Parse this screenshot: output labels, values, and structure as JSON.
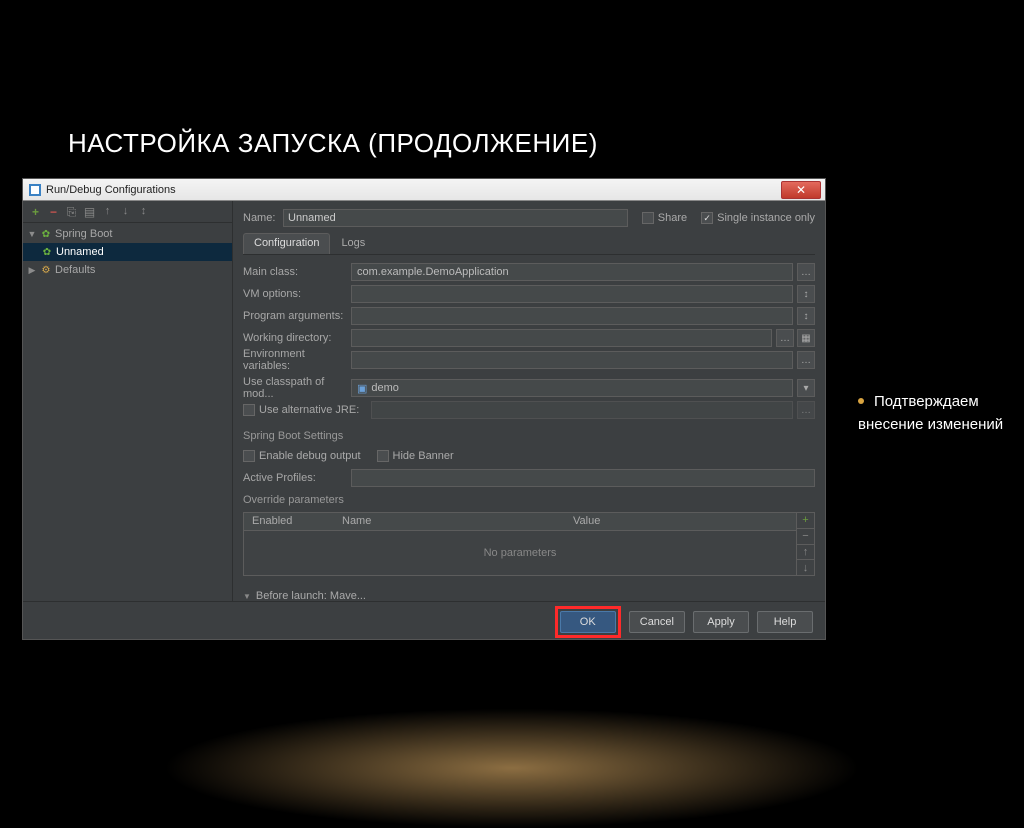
{
  "slide": {
    "title": "НАСТРОЙКА ЗАПУСКА (ПРОДОЛЖЕНИЕ)",
    "bullet": "Подтверждаем внесение изменений"
  },
  "dialog": {
    "title": "Run/Debug Configurations",
    "name_label": "Name:",
    "name_value": "Unnamed",
    "share_label": "Share",
    "single_instance_label": "Single instance only",
    "tabs": {
      "configuration": "Configuration",
      "logs": "Logs"
    },
    "tree": {
      "spring_boot": "Spring Boot",
      "unnamed": "Unnamed",
      "defaults": "Defaults"
    },
    "fields": {
      "main_class_label": "Main class:",
      "main_class_value": "com.example.DemoApplication",
      "vm_options_label": "VM options:",
      "program_args_label": "Program arguments:",
      "working_dir_label": "Working directory:",
      "env_vars_label": "Environment variables:",
      "classpath_label": "Use classpath of mod...",
      "classpath_value": "demo",
      "alt_jre_label": "Use alternative JRE:"
    },
    "spring": {
      "section": "Spring Boot Settings",
      "enable_debug": "Enable debug output",
      "hide_banner": "Hide Banner",
      "active_profiles": "Active Profiles:",
      "override": "Override parameters",
      "col_enabled": "Enabled",
      "col_name": "Name",
      "col_value": "Value",
      "no_params": "No parameters"
    },
    "before_launch": "Before launch: Mave...",
    "buttons": {
      "ok": "OK",
      "cancel": "Cancel",
      "apply": "Apply",
      "help": "Help"
    }
  }
}
